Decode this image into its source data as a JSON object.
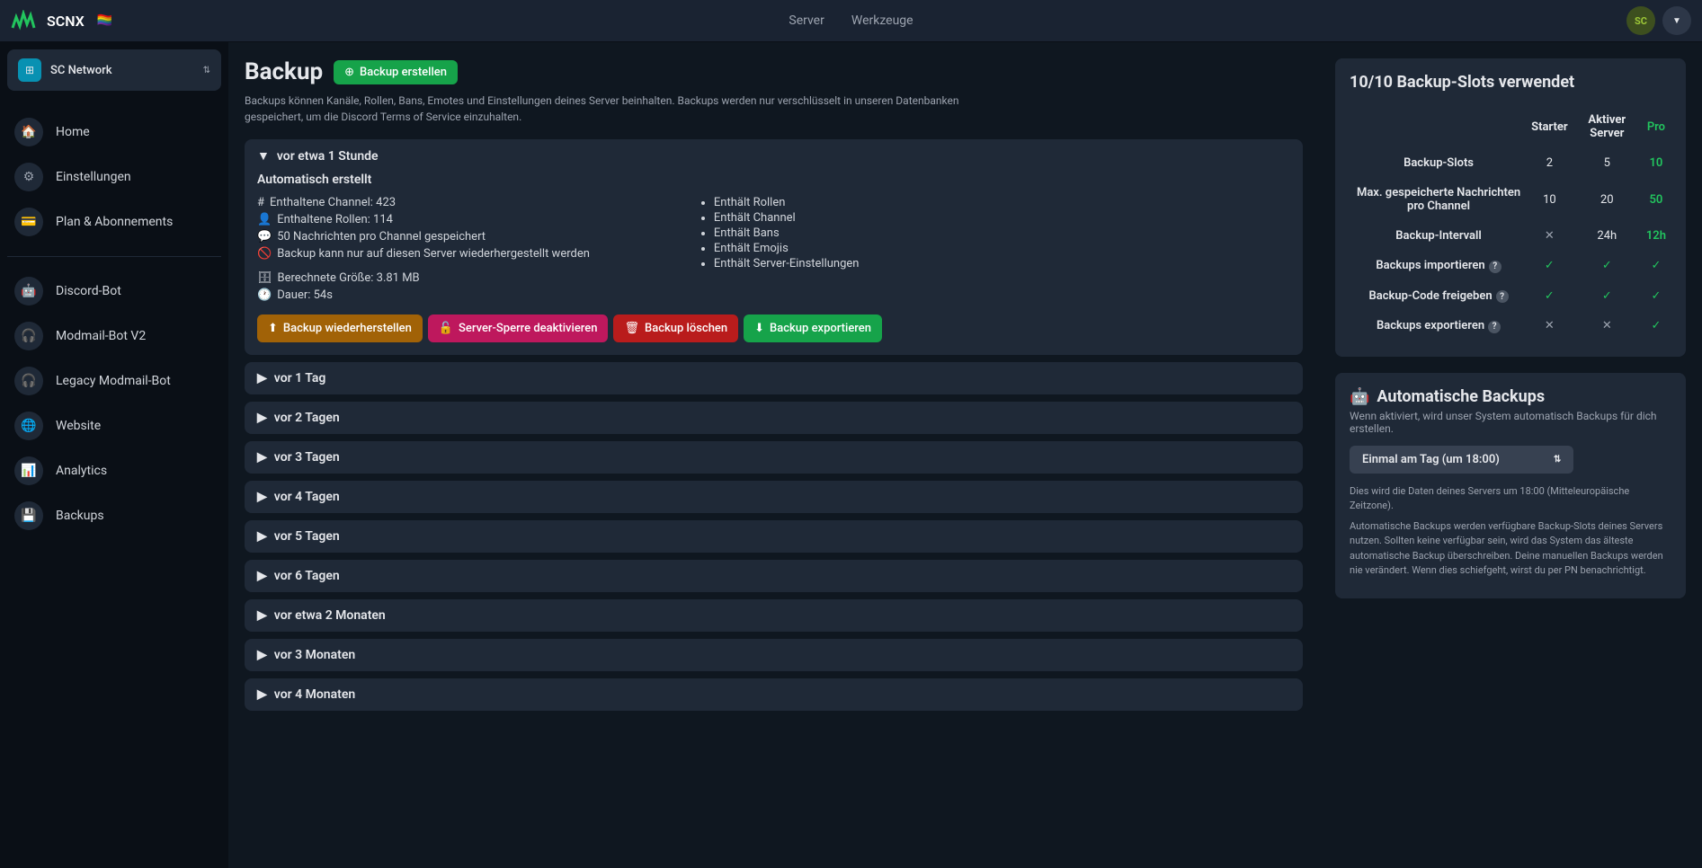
{
  "brand": "SCNX",
  "flag": "🏳️‍🌈",
  "topnav": {
    "server": "Server",
    "tools": "Werkzeuge"
  },
  "avatar": "SC",
  "server": {
    "name": "SC Network"
  },
  "nav": {
    "home": "Home",
    "settings": "Einstellungen",
    "plan": "Plan & Abonnements",
    "discord": "Discord-Bot",
    "modmailv2": "Modmail-Bot V2",
    "legacy": "Legacy Modmail-Bot",
    "website": "Website",
    "analytics": "Analytics",
    "backups": "Backups"
  },
  "page": {
    "title": "Backup",
    "create": "Backup erstellen",
    "desc": "Backups können Kanäle, Rollen, Bans, Emotes und Einstellungen deines Server beinhalten. Backups werden nur verschlüsselt in unseren Datenbanken gespeichert, um die Discord Terms of Service einzuhalten."
  },
  "expanded": {
    "time": "vor etwa 1 Stunde",
    "subtitle": "Automatisch erstellt",
    "meta": {
      "channels": "Enthaltene Channel: 423",
      "roles": "Enthaltene Rollen: 114",
      "messages": "50 Nachrichten pro Channel gespeichert",
      "restrict": "Backup kann nur auf diesen Server wiederhergestellt werden",
      "size": "Berechnete Größe: 3.81 MB",
      "duration": "Dauer: 54s"
    },
    "features": [
      "Enthält Rollen",
      "Enthält Channel",
      "Enthält Bans",
      "Enthält Emojis",
      "Enthält Server-Einstellungen"
    ],
    "buttons": {
      "restore": "Backup wiederherstellen",
      "lock": "Server-Sperre deaktivieren",
      "delete": "Backup löschen",
      "export": "Backup exportieren"
    }
  },
  "collapsed": [
    "vor 1 Tag",
    "vor 2 Tagen",
    "vor 3 Tagen",
    "vor 4 Tagen",
    "vor 5 Tagen",
    "vor 6 Tagen",
    "vor etwa 2 Monaten",
    "vor 3 Monaten",
    "vor 4 Monaten"
  ],
  "slots": {
    "title": "10/10 Backup-Slots verwendet",
    "headers": {
      "starter": "Starter",
      "active": "Aktiver Server",
      "pro": "Pro"
    },
    "rows": {
      "slots": {
        "label": "Backup-Slots",
        "starter": "2",
        "active": "5",
        "pro": "10"
      },
      "messages": {
        "label": "Max. gespeicherte Nachrichten pro Channel",
        "starter": "10",
        "active": "20",
        "pro": "50"
      },
      "interval": {
        "label": "Backup-Intervall",
        "starter": "✕",
        "active": "24h",
        "pro": "12h"
      },
      "import": {
        "label": "Backups importieren",
        "starter": "✓",
        "active": "✓",
        "pro": "✓"
      },
      "code": {
        "label": "Backup-Code freigeben",
        "starter": "✓",
        "active": "✓",
        "pro": "✓"
      },
      "export": {
        "label": "Backups exportieren",
        "starter": "✕",
        "active": "✕",
        "pro": "✓"
      }
    }
  },
  "auto": {
    "title": "Automatische Backups",
    "sub": "Wenn aktiviert, wird unser System automatisch Backups für dich erstellen.",
    "select": "Einmal am Tag (um 18:00)",
    "note1": "Dies wird die Daten deines Servers um 18:00 (Mitteleuropäische Zeitzone).",
    "note2": "Automatische Backups werden verfügbare Backup-Slots deines Servers nutzen. Sollten keine verfügbar sein, wird das System das älteste automatische Backup überschreiben. Deine manuellen Backups werden nie verändert. Wenn dies schiefgeht, wirst du per PN benachrichtigt."
  }
}
